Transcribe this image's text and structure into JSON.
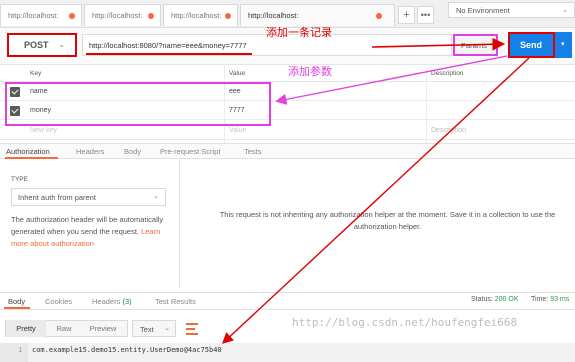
{
  "tabs": [
    {
      "label": "http://localhost:"
    },
    {
      "label": "http://localhost:"
    },
    {
      "label": "http://localhost:"
    },
    {
      "label": "http://localhost:"
    }
  ],
  "environment": {
    "label": "No Environment",
    "chevron_icon": "chevron-down"
  },
  "request": {
    "method": "POST",
    "url": "http://localhost:8080/?name=eee&money=7777",
    "params_label": "Params",
    "send_label": "Send"
  },
  "annotations": {
    "add_record": "添加一条记录",
    "add_params": "添加参数"
  },
  "params_table": {
    "headers": {
      "key": "Key",
      "value": "Value",
      "description": "Description"
    },
    "rows": [
      {
        "key": "name",
        "value": "eee"
      },
      {
        "key": "money",
        "value": "7777"
      }
    ],
    "placeholders": {
      "key": "New key",
      "value": "Value",
      "description": "Description"
    }
  },
  "request_tabs": [
    "Authorization",
    "Headers",
    "Body",
    "Pre-request Script",
    "Tests"
  ],
  "auth": {
    "type_label": "TYPE",
    "type_value": "Inherit auth from parent",
    "help_text": "The authorization header will be automatically generated when you send the request. ",
    "help_link": "Learn more about authorization",
    "message": "This request is not inheriting any authorization helper at the moment. Save it in a collection to use the authorization helper."
  },
  "response_tabs": {
    "body": "Body",
    "cookies": "Cookies",
    "headers": "Headers",
    "headers_count": "(3)",
    "test_results": "Test Results"
  },
  "response_status": {
    "status_label": "Status:",
    "status_value": "200 OK",
    "time_label": "Time:",
    "time_value": "93 ms"
  },
  "format_bar": {
    "pretty": "Pretty",
    "raw": "Raw",
    "preview": "Preview",
    "type": "Text"
  },
  "response_body": {
    "line_number": "1",
    "text": "com.example15.demo15.entity.UserDemo@4ac75b40"
  },
  "watermark": "http://blog.csdn.net/houfengfei668",
  "colors": {
    "accent_orange": "#f26b3a",
    "send_blue": "#1480e8",
    "annotation_red": "#e00000",
    "annotation_magenta": "#e040e0"
  }
}
